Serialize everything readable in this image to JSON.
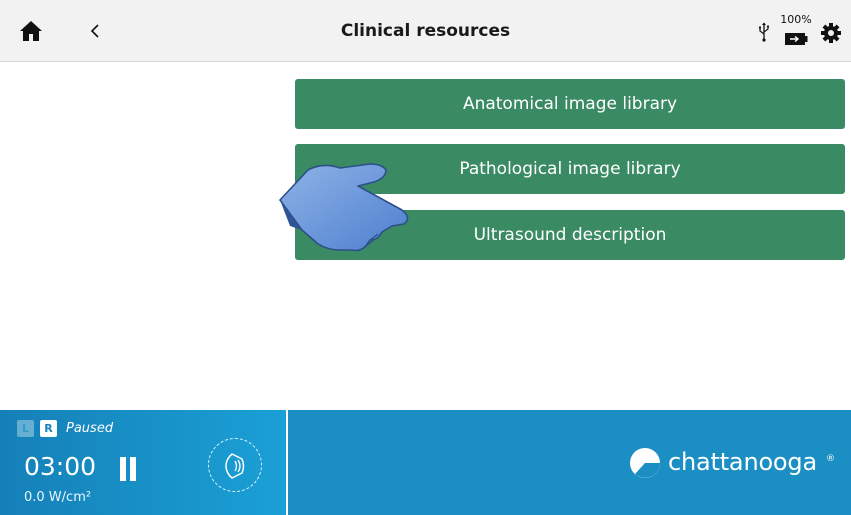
{
  "header": {
    "title": "Clinical resources",
    "battery_percent": "100%"
  },
  "menu": {
    "items": [
      {
        "label": "Anatomical image library"
      },
      {
        "label": "Pathological image library"
      },
      {
        "label": "Ultrasound description"
      }
    ]
  },
  "status": {
    "channel_left": "L",
    "channel_right": "R",
    "state": "Paused",
    "timer": "03:00",
    "intensity": "0.0 W/cm²"
  },
  "brand": {
    "name": "chattanooga",
    "trademark": "®"
  },
  "colors": {
    "button_green": "#3a8b63",
    "bar_blue": "#1b8fc3",
    "header_gray": "#f2f2f2"
  },
  "icons": [
    "home-icon",
    "back-chevron-icon",
    "usb-icon",
    "battery-icon",
    "gear-icon",
    "pointing-hand-icon",
    "pause-icon",
    "ultrasound-head-icon",
    "chattanooga-logo-icon"
  ]
}
